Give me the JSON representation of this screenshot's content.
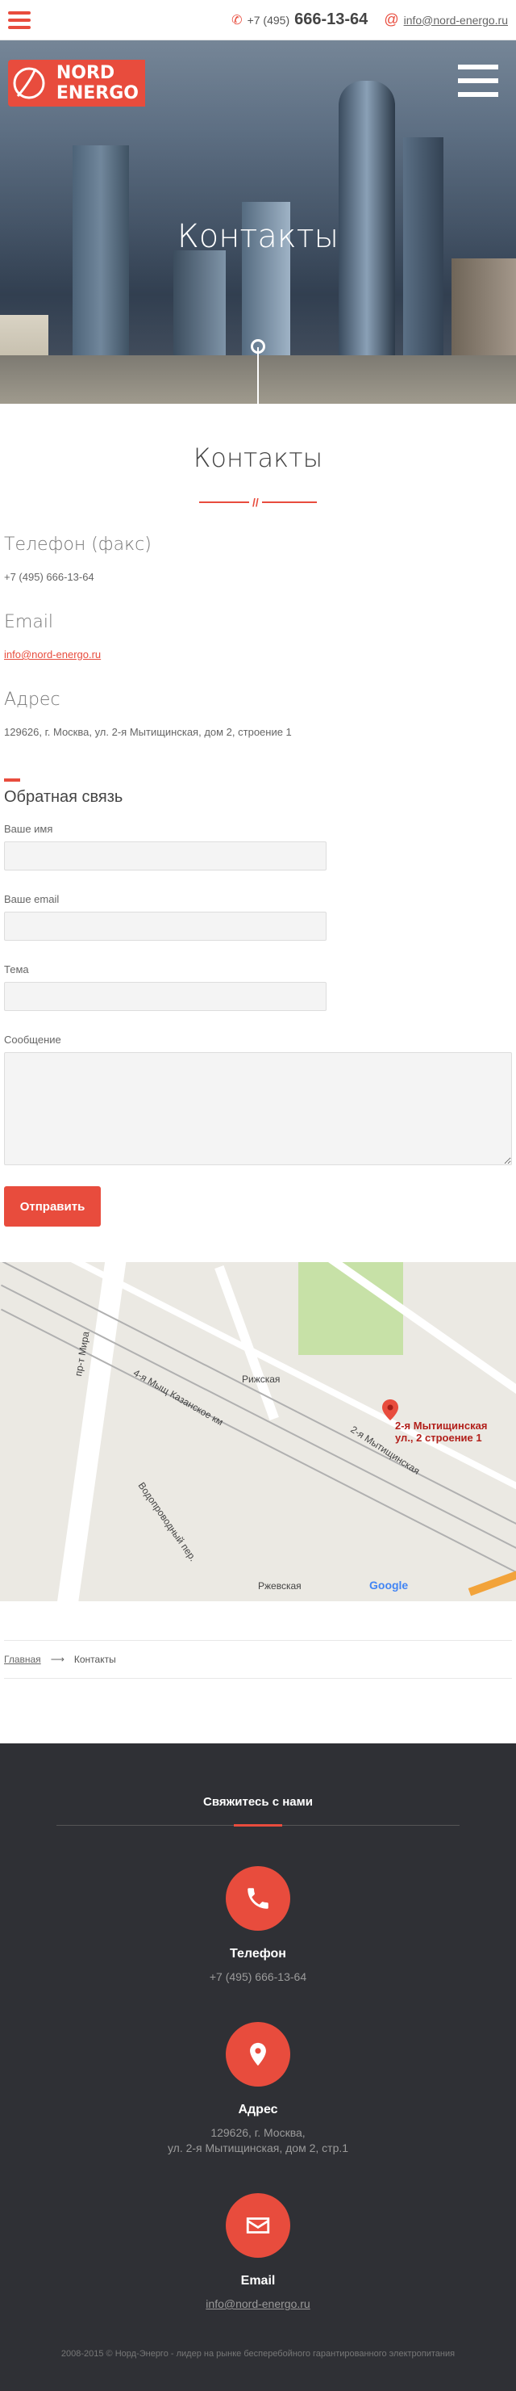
{
  "header": {
    "phone_code": "+7 (495)",
    "phone_number": "666-13-64",
    "email": "info@nord-energo.ru"
  },
  "logo": {
    "line1": "NORD",
    "line2": "ENERGO"
  },
  "hero": {
    "title": "Контакты"
  },
  "content": {
    "title": "Контакты",
    "divider_mark": "//",
    "phone_label": "Телефон (факс)",
    "phone_value": "+7 (495) 666-13-64",
    "email_label": "Email",
    "email_value": "info@nord-energo.ru",
    "address_label": "Адрес",
    "address_value": "129626, г. Москва, ул. 2-я Мытищинская, дом 2, строение 1"
  },
  "feedback": {
    "title": "Обратная связь",
    "name_label": "Ваше имя",
    "email_label": "Ваше email",
    "topic_label": "Тема",
    "message_label": "Сообщение",
    "submit_label": "Отправить"
  },
  "map": {
    "pin_line1": "2-я Мытищинская",
    "pin_line2": "ул., 2 строение 1",
    "metro1": "Рижская",
    "metro2": "Ржевская",
    "street1": "пр-т Мира",
    "street2": "4-я Мыщ Казанское км",
    "street3": "2-я Мытищинская",
    "street4": "Водопроводный пер.",
    "google": "Google"
  },
  "breadcrumb": {
    "home": "Главная",
    "arrow": "⟶",
    "current": "Контакты"
  },
  "footer": {
    "heading": "Свяжитесь с нами",
    "phone_title": "Телефон",
    "phone_value": "+7 (495) 666-13-64",
    "address_title": "Адрес",
    "address_line1": "129626, г. Москва,",
    "address_line2": "ул. 2-я Мытищинская, дом 2, стр.1",
    "email_title": "Email",
    "email_value": "info@nord-energo.ru",
    "copyright": "2008-2015 ©  Норд-Энерго - лидер на рынке бесперебойного гарантированного электропитания"
  },
  "colors": {
    "accent": "#e84c3d",
    "footer_bg": "#2f3035"
  }
}
